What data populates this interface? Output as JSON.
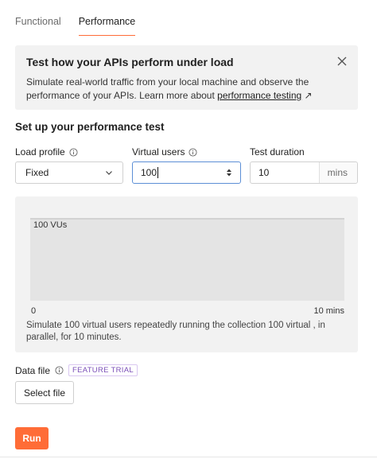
{
  "tabs": [
    {
      "label": "Functional",
      "active": false
    },
    {
      "label": "Performance",
      "active": true
    }
  ],
  "banner": {
    "title": "Test how your APIs perform under load",
    "text_before": "Simulate real-world traffic from your local machine and observe the performance of your APIs. Learn more about ",
    "link": "performance testing",
    "link_arrow": "↗"
  },
  "setup": {
    "title": "Set up your performance test",
    "load_profile": {
      "label": "Load profile",
      "value": "Fixed"
    },
    "virtual_users": {
      "label": "Virtual users",
      "value": "100"
    },
    "test_duration": {
      "label": "Test duration",
      "value": "10",
      "unit": "mins"
    }
  },
  "chart": {
    "vu_label": "100 VUs",
    "x_start": "0",
    "x_end": "10 mins",
    "description": "Simulate 100 virtual users repeatedly running the collection 100 virtual , in parallel, for 10 minutes."
  },
  "data_file": {
    "label": "Data file",
    "badge": "FEATURE TRIAL",
    "button": "Select file"
  },
  "run_button": "Run",
  "colors": {
    "accent": "#ff6c37",
    "focus": "#5c8fd6",
    "badge": "#7b4fb8"
  }
}
